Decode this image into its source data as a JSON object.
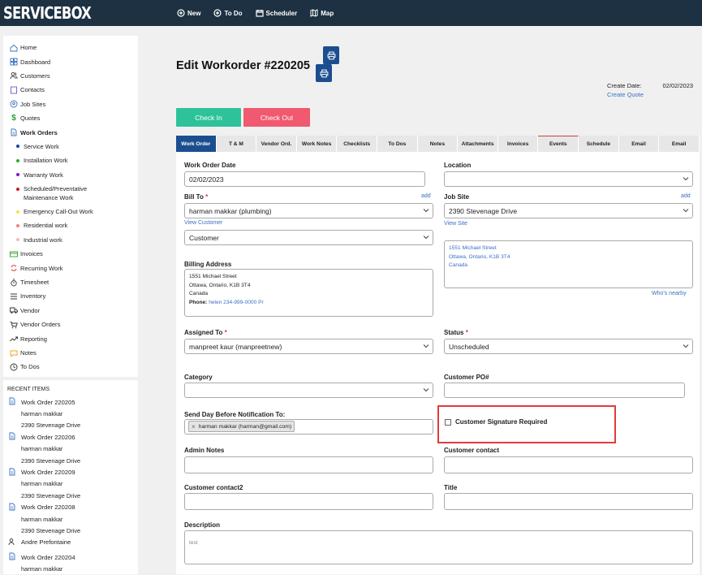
{
  "app": {
    "logo": "SERVICEBOX"
  },
  "topnav": [
    {
      "label": "New",
      "icon": "plus-circle-icon"
    },
    {
      "label": "To Do",
      "icon": "plus-circle-icon"
    },
    {
      "label": "Scheduler",
      "icon": "calendar-icon"
    },
    {
      "label": "Map",
      "icon": "map-icon"
    }
  ],
  "sidebar": {
    "items": [
      {
        "label": "Home",
        "icon": "home-icon"
      },
      {
        "label": "Dashboard",
        "icon": "dashboard-icon"
      },
      {
        "label": "Customers",
        "icon": "users-icon"
      },
      {
        "label": "Contacts",
        "icon": "contacts-icon"
      },
      {
        "label": "Job Sites",
        "icon": "location-pin-icon"
      },
      {
        "label": "Quotes",
        "icon": "dollar-icon"
      },
      {
        "label": "Work Orders",
        "icon": "document-icon"
      }
    ],
    "sub_items": [
      {
        "label": "Service Work",
        "color": "#1b3fa8"
      },
      {
        "label": "Installation Work",
        "color": "#2cae2c"
      },
      {
        "label": "Warranty Work",
        "color": "#7a1fbf"
      },
      {
        "label": "Scheduled/Preventative Maintenance Work",
        "color": "#d01c1c"
      },
      {
        "label": "Emergency Call-Out Work",
        "color": "#f2e05a"
      },
      {
        "label": "Residential work",
        "color": "#f08080"
      },
      {
        "label": "Industrial work",
        "color": "#f7b8b8"
      }
    ],
    "items2": [
      {
        "label": "Invoices",
        "icon": "invoice-icon"
      },
      {
        "label": "Recurring Work",
        "icon": "recurring-icon"
      },
      {
        "label": "Timesheet",
        "icon": "stopwatch-icon"
      },
      {
        "label": "Inventory",
        "icon": "list-icon"
      },
      {
        "label": "Vendor",
        "icon": "truck-icon"
      },
      {
        "label": "Vendor Orders",
        "icon": "cart-icon"
      },
      {
        "label": "Reporting",
        "icon": "trend-icon"
      },
      {
        "label": "Notes",
        "icon": "note-icon"
      },
      {
        "label": "To Dos",
        "icon": "clock-icon"
      }
    ]
  },
  "recent": {
    "heading": "RECENT ITEMS",
    "entries": [
      {
        "title": "Work Order 220205",
        "icon": "document-icon",
        "lines": [
          "harman makkar",
          "2390 Stevenage Drive"
        ]
      },
      {
        "title": "Work Order 220206",
        "icon": "document-icon",
        "lines": [
          "harman makkar",
          "2390 Stevenage Drive"
        ]
      },
      {
        "title": "Work Order 220209",
        "icon": "document-icon",
        "lines": [
          "harman makkar",
          "2390 Stevenage Drive"
        ]
      },
      {
        "title": "Work Order 220208",
        "icon": "document-icon",
        "lines": [
          "harman makkar",
          "2390 Stevenage Drive"
        ]
      },
      {
        "title": "Andre Prefontaine",
        "icon": "users-icon",
        "lines": []
      },
      {
        "title": "Work Order 220204",
        "icon": "document-icon",
        "lines": [
          "harman makkar"
        ]
      }
    ]
  },
  "header": {
    "title": "Edit Workorder #220205",
    "create_date_label": "Create Date:",
    "create_date_value": "02/02/2023",
    "create_quote": "Create Quote"
  },
  "buttons": {
    "check_in": "Check In",
    "check_out": "Check Out"
  },
  "tabs": [
    "Work Order",
    "T & M",
    "Vendor Ord.",
    "Work Notes",
    "Checklists",
    "To Dos",
    "Notes",
    "Attachments",
    "Invoices",
    "Events",
    "Schedule",
    "Email",
    "Email"
  ],
  "form": {
    "work_order_date_label": "Work Order Date",
    "work_order_date_value": "02/02/2023",
    "location_label": "Location",
    "location_value": "",
    "bill_to_label": "Bill To",
    "bill_to_value": "harman makkar (plumbing)",
    "add": "add",
    "view_customer": "View Customer",
    "customer_type_value": "Customer",
    "job_site_label": "Job Site",
    "job_site_value": "2390 Stevenage Drive",
    "view_site": "View Site",
    "site_address": [
      "1551 Michael Street",
      "Ottawa, Ontario, K1B 3T4",
      "Canada"
    ],
    "whos_nearby": "Who's nearby",
    "billing_address_label": "Billing Address",
    "billing_address": [
      "1551 Michael Street",
      "Ottawa, Ontario, K1B 3T4",
      "Canada"
    ],
    "phone_label": "Phone:",
    "phone_value": "helen 234-999-0000 Pr",
    "assigned_to_label": "Assigned To",
    "assigned_to_value": "manpreet kaur (manpreetnew)",
    "status_label": "Status",
    "status_value": "Unscheduled",
    "category_label": "Category",
    "category_value": "",
    "customer_po_label": "Customer PO#",
    "customer_po_value": "",
    "send_day_label": "Send Day Before Notification To:",
    "send_day_chip": "harman makkar (harman@gmail.com)",
    "signature_label": "Customer Signature Required",
    "admin_notes_label": "Admin Notes",
    "customer_contact_label": "Customer contact",
    "customer_contact2_label": "Customer contact2",
    "title_label": "Title",
    "description_label": "Description",
    "description_value": "test"
  }
}
